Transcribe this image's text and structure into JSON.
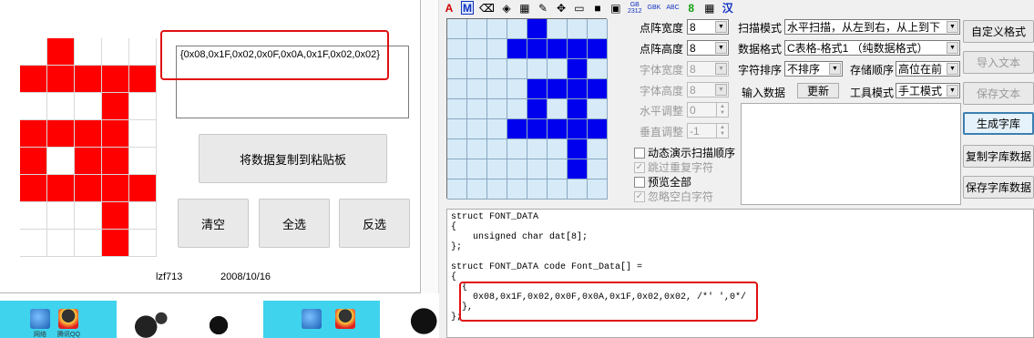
{
  "left_window": {
    "bitmap_rows": [
      [
        0,
        1,
        0,
        0,
        0
      ],
      [
        1,
        1,
        1,
        1,
        1
      ],
      [
        0,
        0,
        0,
        1,
        0
      ],
      [
        1,
        1,
        1,
        1,
        0
      ],
      [
        1,
        0,
        1,
        1,
        0
      ],
      [
        1,
        1,
        1,
        1,
        1
      ],
      [
        0,
        0,
        0,
        1,
        0
      ],
      [
        0,
        0,
        0,
        1,
        0
      ]
    ],
    "hex_text": "{0x08,0x1F,0x02,0x0F,0x0A,0x1F,0x02,0x02}",
    "copy_button": "将数据复制到粘贴板",
    "clear_button": "清空",
    "select_all_button": "全选",
    "invert_button": "反选",
    "author": "lzf713",
    "date": "2008/10/16",
    "colors": {
      "pixel_on": "#ff0000",
      "highlight": "#e01010"
    }
  },
  "taskstrip": {
    "icons": [
      {
        "name": "network-icon",
        "label": "网络"
      },
      {
        "name": "qq-icon",
        "label": "腾讯QQ"
      }
    ]
  },
  "toolbar": {
    "items": [
      {
        "name": "font-a-icon",
        "text": "A"
      },
      {
        "name": "font-m-icon",
        "text": "M"
      },
      {
        "name": "eraser-icon",
        "text": "⌫"
      },
      {
        "name": "fill-icon",
        "text": "◈"
      },
      {
        "name": "palette-icon",
        "text": "▦"
      },
      {
        "name": "pencil-icon",
        "text": "✎"
      },
      {
        "name": "move-icon",
        "text": "✥"
      },
      {
        "name": "open-folder-icon",
        "text": "▭"
      },
      {
        "name": "save-icon",
        "text": "■"
      },
      {
        "name": "save-as-icon",
        "text": "▣"
      },
      {
        "name": "gb2312-icon",
        "text": "GB\n2312"
      },
      {
        "name": "gbk-icon",
        "text": "GBK"
      },
      {
        "name": "abc-icon",
        "text": "ABC"
      },
      {
        "name": "digit-8-icon",
        "text": "8"
      },
      {
        "name": "grid-color-icon",
        "text": "▦"
      },
      {
        "name": "han-icon",
        "text": "汉"
      }
    ]
  },
  "editor": {
    "bitmap_rows": [
      [
        0,
        0,
        0,
        0,
        1,
        0,
        0,
        0
      ],
      [
        0,
        0,
        0,
        1,
        1,
        1,
        1,
        1
      ],
      [
        0,
        0,
        0,
        0,
        0,
        0,
        1,
        0
      ],
      [
        0,
        0,
        0,
        0,
        1,
        1,
        1,
        1
      ],
      [
        0,
        0,
        0,
        0,
        1,
        0,
        1,
        0
      ],
      [
        0,
        0,
        0,
        1,
        1,
        1,
        1,
        1
      ],
      [
        0,
        0,
        0,
        0,
        0,
        0,
        1,
        0
      ],
      [
        0,
        0,
        0,
        0,
        0,
        0,
        1,
        0
      ],
      [
        0,
        0,
        0,
        0,
        0,
        0,
        0,
        0
      ]
    ],
    "colors": {
      "pixel_on": "#0000ee",
      "pixel_off": "#d6eaf8"
    }
  },
  "settings": {
    "matrix_width_label": "点阵宽度",
    "matrix_width_value": "8",
    "matrix_height_label": "点阵高度",
    "matrix_height_value": "8",
    "font_width_label": "字体宽度",
    "font_width_value": "8",
    "font_height_label": "字体高度",
    "font_height_value": "8",
    "h_adjust_label": "水平调整",
    "h_adjust_value": "0",
    "v_adjust_label": "垂直调整",
    "v_adjust_value": "-1",
    "scan_mode_label": "扫描模式",
    "scan_mode_value": "水平扫描，从左到右，从上到下",
    "data_format_label": "数据格式",
    "data_format_value": "C表格-格式1 （纯数据格式）",
    "char_sort_label": "字符排序",
    "char_sort_value": "不排序",
    "storage_order_label": "存储顺序",
    "storage_order_value": "高位在前",
    "input_data_label": "输入数据",
    "update_button": "更新",
    "tool_mode_label": "工具模式",
    "tool_mode_value": "手工模式",
    "checkboxes": [
      {
        "label": "动态演示扫描顺序",
        "checked": ""
      },
      {
        "label": "跳过重复字符",
        "checked": "✓"
      },
      {
        "label": "预览全部",
        "checked": ""
      },
      {
        "label": "忽略空白字符",
        "checked": "✓"
      }
    ]
  },
  "right_buttons": {
    "custom_format": "自定义格式",
    "import_text": "导入文本",
    "save_text": "保存文本",
    "generate_font": "生成字库",
    "copy_font_data": "复制字库数据",
    "save_font_data": "保存字库数据"
  },
  "code_lines": [
    "struct FONT_DATA",
    "{",
    "    unsigned char dat[8];",
    "};",
    "",
    "struct FONT_DATA code Font_Data[] =",
    "{",
    "  {",
    "    0x08,0x1F,0x02,0x0F,0x0A,0x1F,0x02,0x02, /*' ',0*/",
    "  },",
    "};"
  ]
}
